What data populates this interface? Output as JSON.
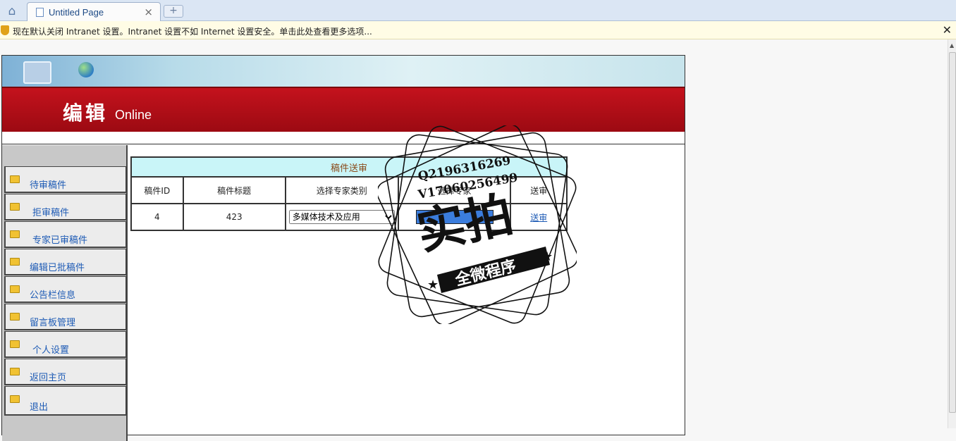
{
  "browser": {
    "tab_title": "Untitled Page",
    "tab_close": "×",
    "new_tab": "+",
    "info_message": "现在默认关闭 Intranet 设置。Intranet 设置不如 Internet 设置安全。单击此处查看更多选项...",
    "info_close": "✕"
  },
  "header": {
    "logo_cn": "编辑",
    "logo_en": "Online"
  },
  "sidebar": {
    "items": [
      {
        "label": "待审稿件"
      },
      {
        "label": "拒审稿件"
      },
      {
        "label": "专家已审稿件"
      },
      {
        "label": "编辑已批稿件"
      },
      {
        "label": "公告栏信息"
      },
      {
        "label": "留言板管理"
      },
      {
        "label": "个人设置"
      },
      {
        "label": "返回主页"
      },
      {
        "label": "退出"
      }
    ]
  },
  "table": {
    "caption": "稿件送审",
    "headers": [
      "稿件ID",
      "稿件标题",
      "选择专家类别",
      "选择专家",
      "送审"
    ],
    "row": {
      "id": "4",
      "title": "423",
      "category": "多媒体技术及应用",
      "send_label": "送审"
    }
  },
  "watermark": {
    "line1": "Q2196316269",
    "line2": "V17060256499",
    "big_text": "实拍",
    "ribbon_text": "全微程序"
  }
}
